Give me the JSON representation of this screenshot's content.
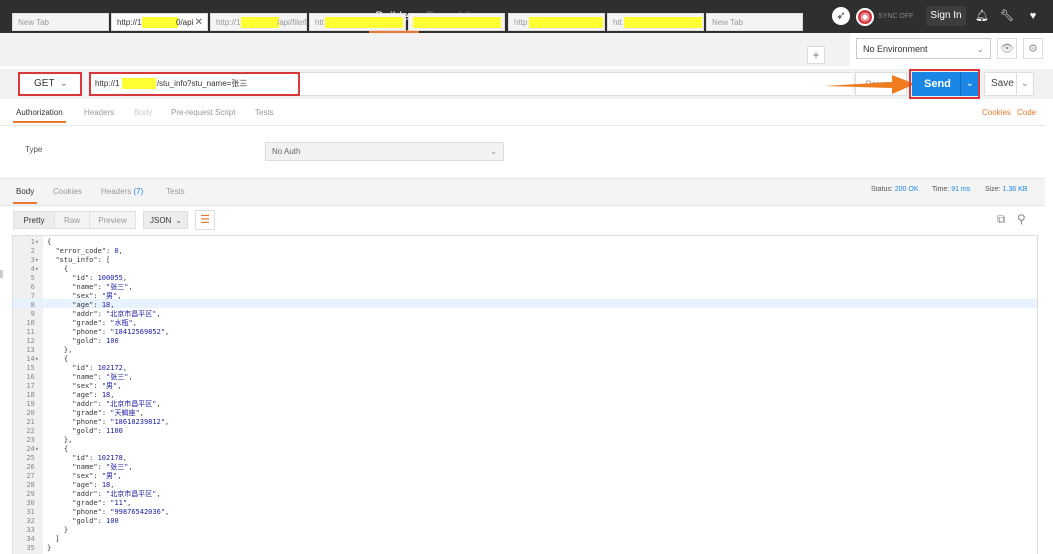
{
  "topbar": {
    "builder_tab": "Builder",
    "library_tab": "Team Library",
    "sync_status": "SYNC OFF",
    "sign_in": "Sign In"
  },
  "request_tabs": [
    {
      "label": "New Tab"
    },
    {
      "label": "http://1",
      "suffix": "0/api",
      "active": true
    },
    {
      "label": "http://1",
      "suffix": "/api/file/fi"
    },
    {
      "label": "htt"
    },
    {
      "label": ""
    },
    {
      "label": "http"
    },
    {
      "label": "htt"
    },
    {
      "label": "New Tab"
    }
  ],
  "new_tab_button": "+",
  "environment": {
    "selected": "No Environment"
  },
  "request": {
    "method": "GET",
    "url": "http://1            0/api/user/stu_info?stu_name=张三",
    "params_label": "Params",
    "send_label": "Send",
    "save_label": "Save"
  },
  "request_tabs_section": {
    "tabs": [
      "Authorization",
      "Headers",
      "Body",
      "Pre-request Script",
      "Tests"
    ],
    "cookies_link": "Cookies",
    "code_link": "Code"
  },
  "auth": {
    "type_label": "Type",
    "type_value": "No Auth"
  },
  "response": {
    "tabs": {
      "body": "Body",
      "cookies": "Cookies",
      "headers": "Headers",
      "headers_count": "(7)",
      "tests": "Tests"
    },
    "status_label": "Status:",
    "status_value": "200 OK",
    "time_label": "Time:",
    "time_value": "91 ms",
    "size_label": "Size:",
    "size_value": "1.36 KB",
    "formats": [
      "Pretty",
      "Raw",
      "Preview"
    ],
    "language": "JSON"
  },
  "editor": {
    "lines": [
      "{",
      "  \"error_code\": 0,",
      "  \"stu_info\": [",
      "    {",
      "      \"id\": 100055,",
      "      \"name\": \"张三\",",
      "      \"sex\": \"男\",",
      "      \"age\": 18,",
      "      \"addr\": \"北京市昌平区\",",
      "      \"grade\": \"水瓶\",",
      "      \"phone\": \"18412569852\",",
      "      \"gold\": 100",
      "    },",
      "    {",
      "      \"id\": 102172,",
      "      \"name\": \"张三\",",
      "      \"sex\": \"男\",",
      "      \"age\": 18,",
      "      \"addr\": \"北京市昌平区\",",
      "      \"grade\": \"天蝎座\",",
      "      \"phone\": \"18618239812\",",
      "      \"gold\": 1100",
      "    },",
      "    {",
      "      \"id\": 102178,",
      "      \"name\": \"张三\",",
      "      \"sex\": \"男\",",
      "      \"age\": 18,",
      "      \"addr\": \"北京市昌平区\",",
      "      \"grade\": \"11\",",
      "      \"phone\": \"99876542036\",",
      "      \"gold\": 100",
      "    }",
      "  ]",
      "}"
    ],
    "fold_lines": [
      1,
      3,
      4,
      14,
      24
    ]
  },
  "colors": {
    "accent": "#e8792f",
    "send": "#1a87e6",
    "highlight": "#d9363e",
    "topbar": "#2f2f2f"
  }
}
